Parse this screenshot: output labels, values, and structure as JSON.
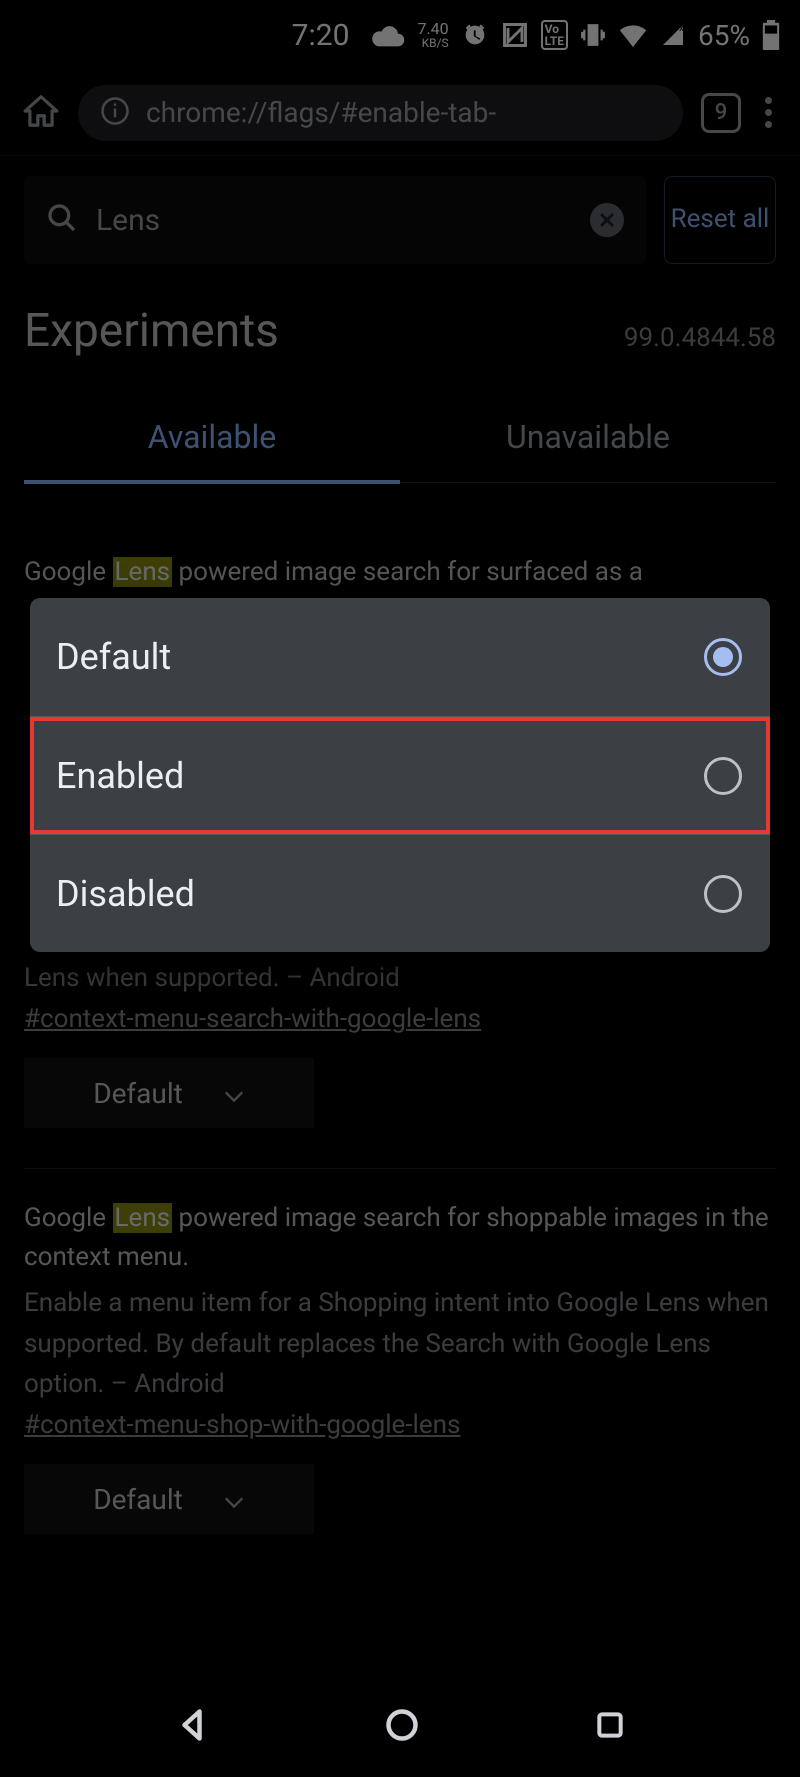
{
  "status": {
    "time": "7:20",
    "net_speed_value": "7.40",
    "net_speed_unit": "KB/S",
    "battery_pct": "65%"
  },
  "toolbar": {
    "url": "chrome://flags/#enable-tab-",
    "tab_count": "9"
  },
  "search": {
    "value": "Lens",
    "reset_label": "Reset all"
  },
  "header": {
    "title": "Experiments",
    "version": "99.0.4844.58"
  },
  "tabs": {
    "available": "Available",
    "unavailable": "Unavailable"
  },
  "flag1": {
    "title_pre": "Google ",
    "title_hl": "Lens",
    "title_post": " powered image search for surfaced as a",
    "desc_tail": "Lens when supported. – Android",
    "hash": "#context-menu-search-with-google-lens",
    "dropdown": "Default"
  },
  "flag2": {
    "title_pre": "Google ",
    "title_hl": "Lens",
    "title_post": " powered image search for shoppable images in the context menu.",
    "desc": "Enable a menu item for a Shopping intent into Google Lens when supported. By default replaces the Search with Google Lens option. – Android",
    "hash": "#context-menu-shop-with-google-lens",
    "dropdown": "Default"
  },
  "popup": {
    "opt_default": "Default",
    "opt_enabled": "Enabled",
    "opt_disabled": "Disabled"
  }
}
